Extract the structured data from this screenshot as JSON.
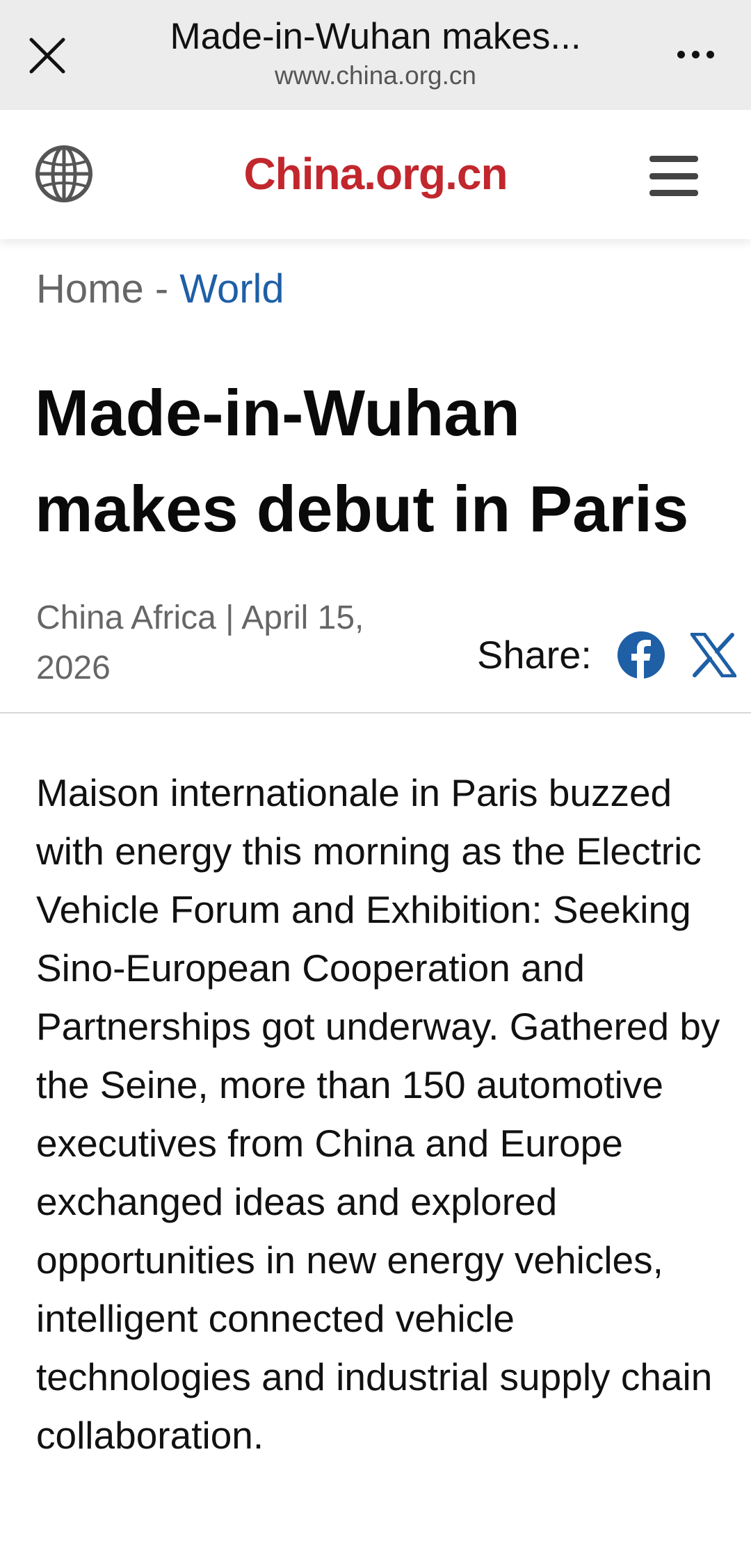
{
  "browser": {
    "title": "Made-in-Wuhan makes...",
    "url": "www.china.org.cn"
  },
  "site": {
    "logo": "China.org.cn",
    "brand_color": "#c1272d"
  },
  "breadcrumb": {
    "home": "Home",
    "separator": " - ",
    "section": "World"
  },
  "article": {
    "headline": "Made-in-Wuhan makes debut in Paris",
    "source": "China Africa",
    "meta_separator": " | ",
    "date": "April 15, 2026",
    "share_label": "Share:",
    "body": "Maison internationale in Paris buzzed with energy this morning as the Electric Vehicle Forum and Exhibition: Seeking Sino-European Cooperation and Partnerships got underway. Gathered by the Seine, more than 150 automotive executives from China and Europe exchanged ideas and explored opportunities in new energy vehicles, intelligent connected vehicle technologies and industrial supply chain collaboration."
  },
  "icons": {
    "close": "close-icon",
    "more": "more-icon",
    "globe": "globe-icon",
    "menu": "hamburger-menu-icon",
    "facebook": "facebook-icon",
    "x": "x-twitter-icon"
  },
  "colors": {
    "link": "#1e5fa6",
    "facebook": "#1877f2",
    "x": "#1e5fa6",
    "browser_bar": "#ececec"
  }
}
